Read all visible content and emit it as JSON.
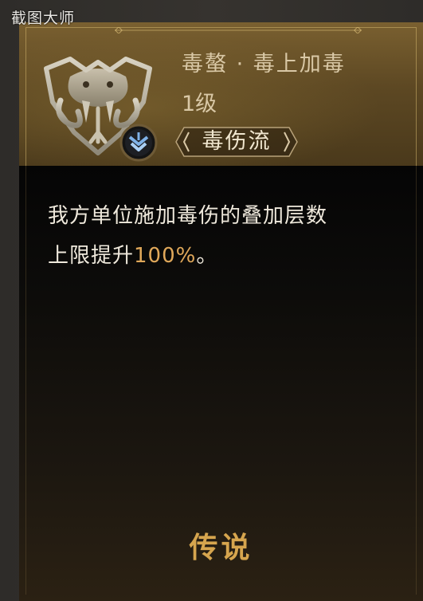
{
  "watermark": "截图大师",
  "skill": {
    "name": "毒螯 · 毒上加毒",
    "level": "1级",
    "tag": "毒伤流",
    "emblem_icon": "serpent-crest-icon",
    "tree_icon": "arrow-down-chevron-icon"
  },
  "description": {
    "line1": "我方单位施加毒伤的叠加层数",
    "line2_prefix": "上限提升",
    "line2_value": "100%",
    "line2_suffix": "。"
  },
  "rarity": "传说",
  "colors": {
    "header_gold": "#6b5228",
    "text_light": "#d9c8a6",
    "highlight": "#e0a85a",
    "rarity": "#d6a54e",
    "badge_blue": "#7fb2e8"
  }
}
